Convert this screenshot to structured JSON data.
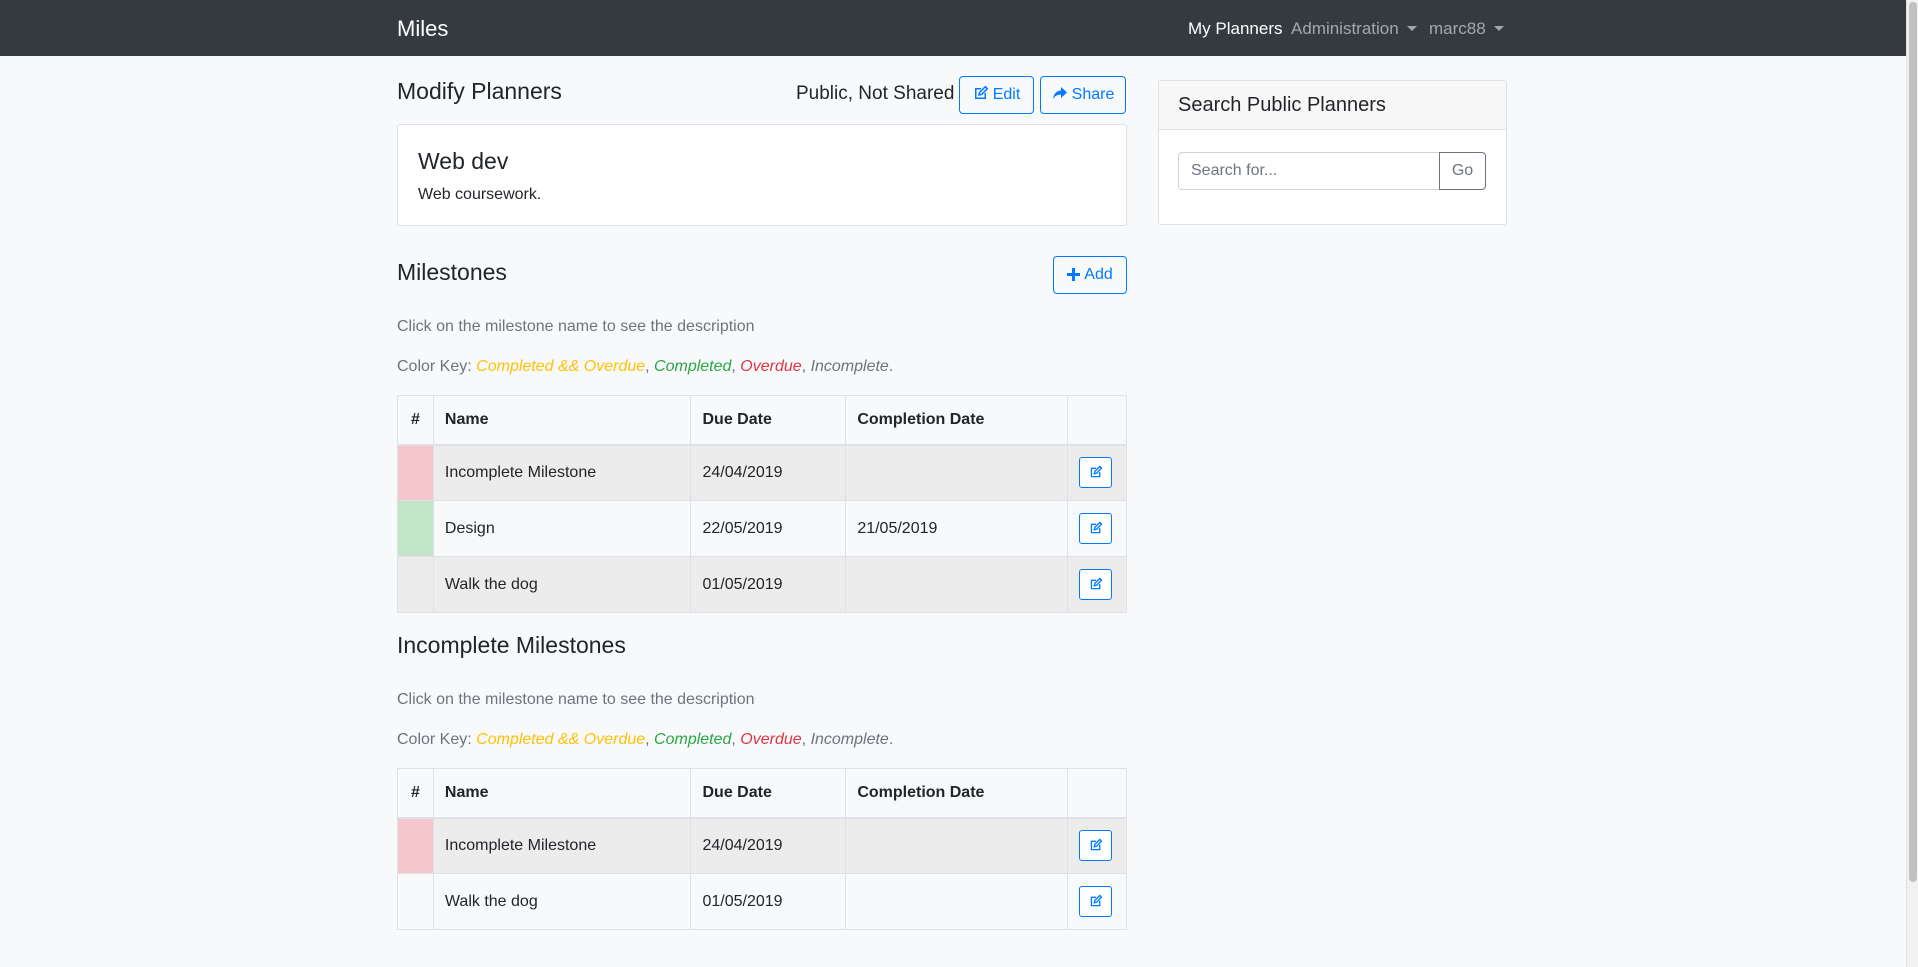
{
  "navbar": {
    "brand": "Miles",
    "links": [
      {
        "label": "My Planners",
        "active": true
      },
      {
        "label": "Administration",
        "dropdown": true
      },
      {
        "label": "marc88",
        "dropdown": true
      }
    ]
  },
  "header": {
    "title": "Modify Planners",
    "status": "Public, Not Shared",
    "edit_label": "Edit",
    "share_label": "Share"
  },
  "planner": {
    "name": "Web dev",
    "description": "Web coursework."
  },
  "milestones": {
    "title": "Milestones",
    "add_label": "Add",
    "hint": "Click on the milestone name to see the description",
    "key_label": "Color Key:",
    "key_items": [
      "Completed && Overdue",
      "Completed",
      "Overdue",
      "Incomplete"
    ],
    "columns": [
      "#",
      "Name",
      "Due Date",
      "Completion Date",
      ""
    ],
    "rows": [
      {
        "name": "Incomplete Milestone",
        "due": "24/04/2019",
        "completed": "",
        "status": "overdue"
      },
      {
        "name": "Design",
        "due": "22/05/2019",
        "completed": "21/05/2019",
        "status": "completed"
      },
      {
        "name": "Walk the dog",
        "due": "01/05/2019",
        "completed": "",
        "status": "incomplete"
      }
    ]
  },
  "incomplete": {
    "title": "Incomplete Milestones",
    "hint": "Click on the milestone name to see the description",
    "key_label": "Color Key:",
    "key_items": [
      "Completed && Overdue",
      "Completed",
      "Overdue",
      "Incomplete"
    ],
    "columns": [
      "#",
      "Name",
      "Due Date",
      "Completion Date",
      ""
    ],
    "rows": [
      {
        "name": "Incomplete Milestone",
        "due": "24/04/2019",
        "completed": "",
        "status": "overdue"
      },
      {
        "name": "Walk the dog",
        "due": "01/05/2019",
        "completed": "",
        "status": "incomplete"
      }
    ]
  },
  "sidebar": {
    "title": "Search Public Planners",
    "search_placeholder": "Search for...",
    "go_label": "Go"
  },
  "colors": {
    "navbar": "#343a40",
    "primary": "#007bff",
    "overdue_flag": "#f5c6cb",
    "completed_flag": "#c3e6cb",
    "incomplete_flag": "#e9ecef"
  }
}
